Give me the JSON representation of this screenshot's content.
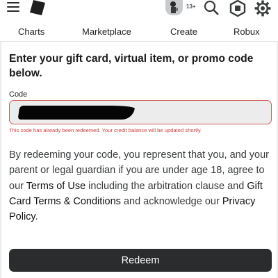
{
  "header": {
    "age_badge": "13+",
    "icons": [
      "hamburger-menu-icon",
      "roblox-logo-icon",
      "avatar-icon",
      "search-icon",
      "robux-icon",
      "gear-icon"
    ]
  },
  "nav": {
    "items": [
      {
        "label": "Charts"
      },
      {
        "label": "Marketplace"
      },
      {
        "label": "Create"
      },
      {
        "label": "Robux"
      }
    ]
  },
  "redeem": {
    "heading": "Enter your gift card, virtual item, or promo code below.",
    "code_label": "Code",
    "code_value": "",
    "error": "This code has already been redeemed. Your credit balance will be updated shortly.",
    "notice_1": "By redeeming your code, you represent that you, and your parent or legal guardian if you are under age 18, agree to our ",
    "terms_link": "Terms of Use",
    "notice_2": " including the arbitration clause and ",
    "gift_card_link": "Gift Card Terms & Conditions",
    "notice_3": " and acknowledge our ",
    "privacy_link": "Privacy Policy",
    "notice_4": ".",
    "button_label": "Redeem"
  },
  "colors": {
    "error": "#c83f3f",
    "button_bg": "#2b2c2e",
    "input_border": "#d05c5c",
    "input_bg": "#ececec"
  }
}
